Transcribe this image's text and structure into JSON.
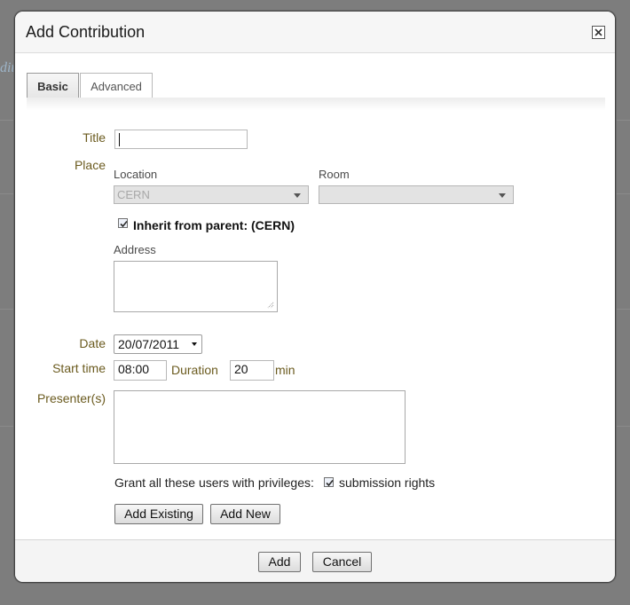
{
  "background": {
    "text_fragment": "dit"
  },
  "dialog": {
    "title": "Add Contribution",
    "close_icon": "close-icon"
  },
  "tabs": [
    {
      "label": "Basic",
      "active": true
    },
    {
      "label": "Advanced",
      "active": false
    }
  ],
  "form": {
    "title_label": "Title",
    "title_value": "",
    "place_label": "Place",
    "location_label": "Location",
    "location_value": "CERN",
    "room_label": "Room",
    "room_value": "",
    "inherit_label": "Inherit from parent: (CERN)",
    "inherit_checked": true,
    "address_label": "Address",
    "address_value": "",
    "date_label": "Date",
    "date_value": "20/07/2011",
    "start_time_label": "Start time",
    "start_time_value": "08:00",
    "duration_label": "Duration",
    "duration_value": "20",
    "duration_unit": "min",
    "presenters_label": "Presenter(s)",
    "grant_label": "Grant all these users with privileges:",
    "submission_label": "submission rights",
    "submission_checked": true,
    "add_existing_label": "Add Existing",
    "add_new_label": "Add New"
  },
  "footer": {
    "add_label": "Add",
    "cancel_label": "Cancel"
  },
  "colors": {
    "label": "#6b5b1f",
    "overlay": "#7d7d7d",
    "tab_active_bg": "#e6e6e6"
  }
}
